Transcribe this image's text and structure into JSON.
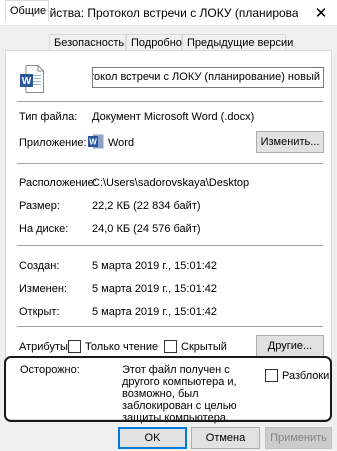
{
  "window": {
    "title": "Свойства: Протокол встречи с ЛОКУ (планирование) н...",
    "close_glyph": "✕"
  },
  "tabs": [
    {
      "label": "Общие",
      "active": true
    },
    {
      "label": "Безопасность",
      "active": false
    },
    {
      "label": "Подробно",
      "active": false
    },
    {
      "label": "Предыдущие версии",
      "active": false
    }
  ],
  "file": {
    "name_value": "ротокол встречи с ЛОКУ (планирование) новый",
    "icon": "word-document-icon"
  },
  "props": {
    "type_label": "Тип файла:",
    "type_value": "Документ Microsoft Word (.docx)",
    "app_label": "Приложение:",
    "app_value": "Word",
    "app_icon": "word-app-icon",
    "change_button": "Изменить...",
    "location_label": "Расположение:",
    "location_value": "C:\\Users\\sadorovskaya\\Desktop",
    "size_label": "Размер:",
    "size_value": "22,2 КБ (22 834 байт)",
    "disk_label": "На диске:",
    "disk_value": "24,0 КБ (24 576 байт)",
    "created_label": "Создан:",
    "created_value": "5 марта 2019 г., 15:01:42",
    "modified_label": "Изменен:",
    "modified_value": "5 марта 2019 г., 15:01:42",
    "opened_label": "Открыт:",
    "opened_value": "5 марта 2019 г., 15:01:42",
    "attributes_label": "Атрибуты:",
    "readonly_label": "Только чтение",
    "hidden_label": "Скрытый",
    "other_button": "Другие...",
    "security_label": "Осторожно:",
    "security_text": "Этот файл получен с другого компьютера и, возможно, был заблокирован с целью защиты компьютера.",
    "unblock_label": "Разблокировать"
  },
  "buttons": {
    "ok": "OK",
    "cancel": "Отмена",
    "apply": "Применить"
  },
  "colors": {
    "word_blue": "#2b579a",
    "highlight_border": "#1a1a1a",
    "dialog_bg": "#f0f0f0"
  }
}
